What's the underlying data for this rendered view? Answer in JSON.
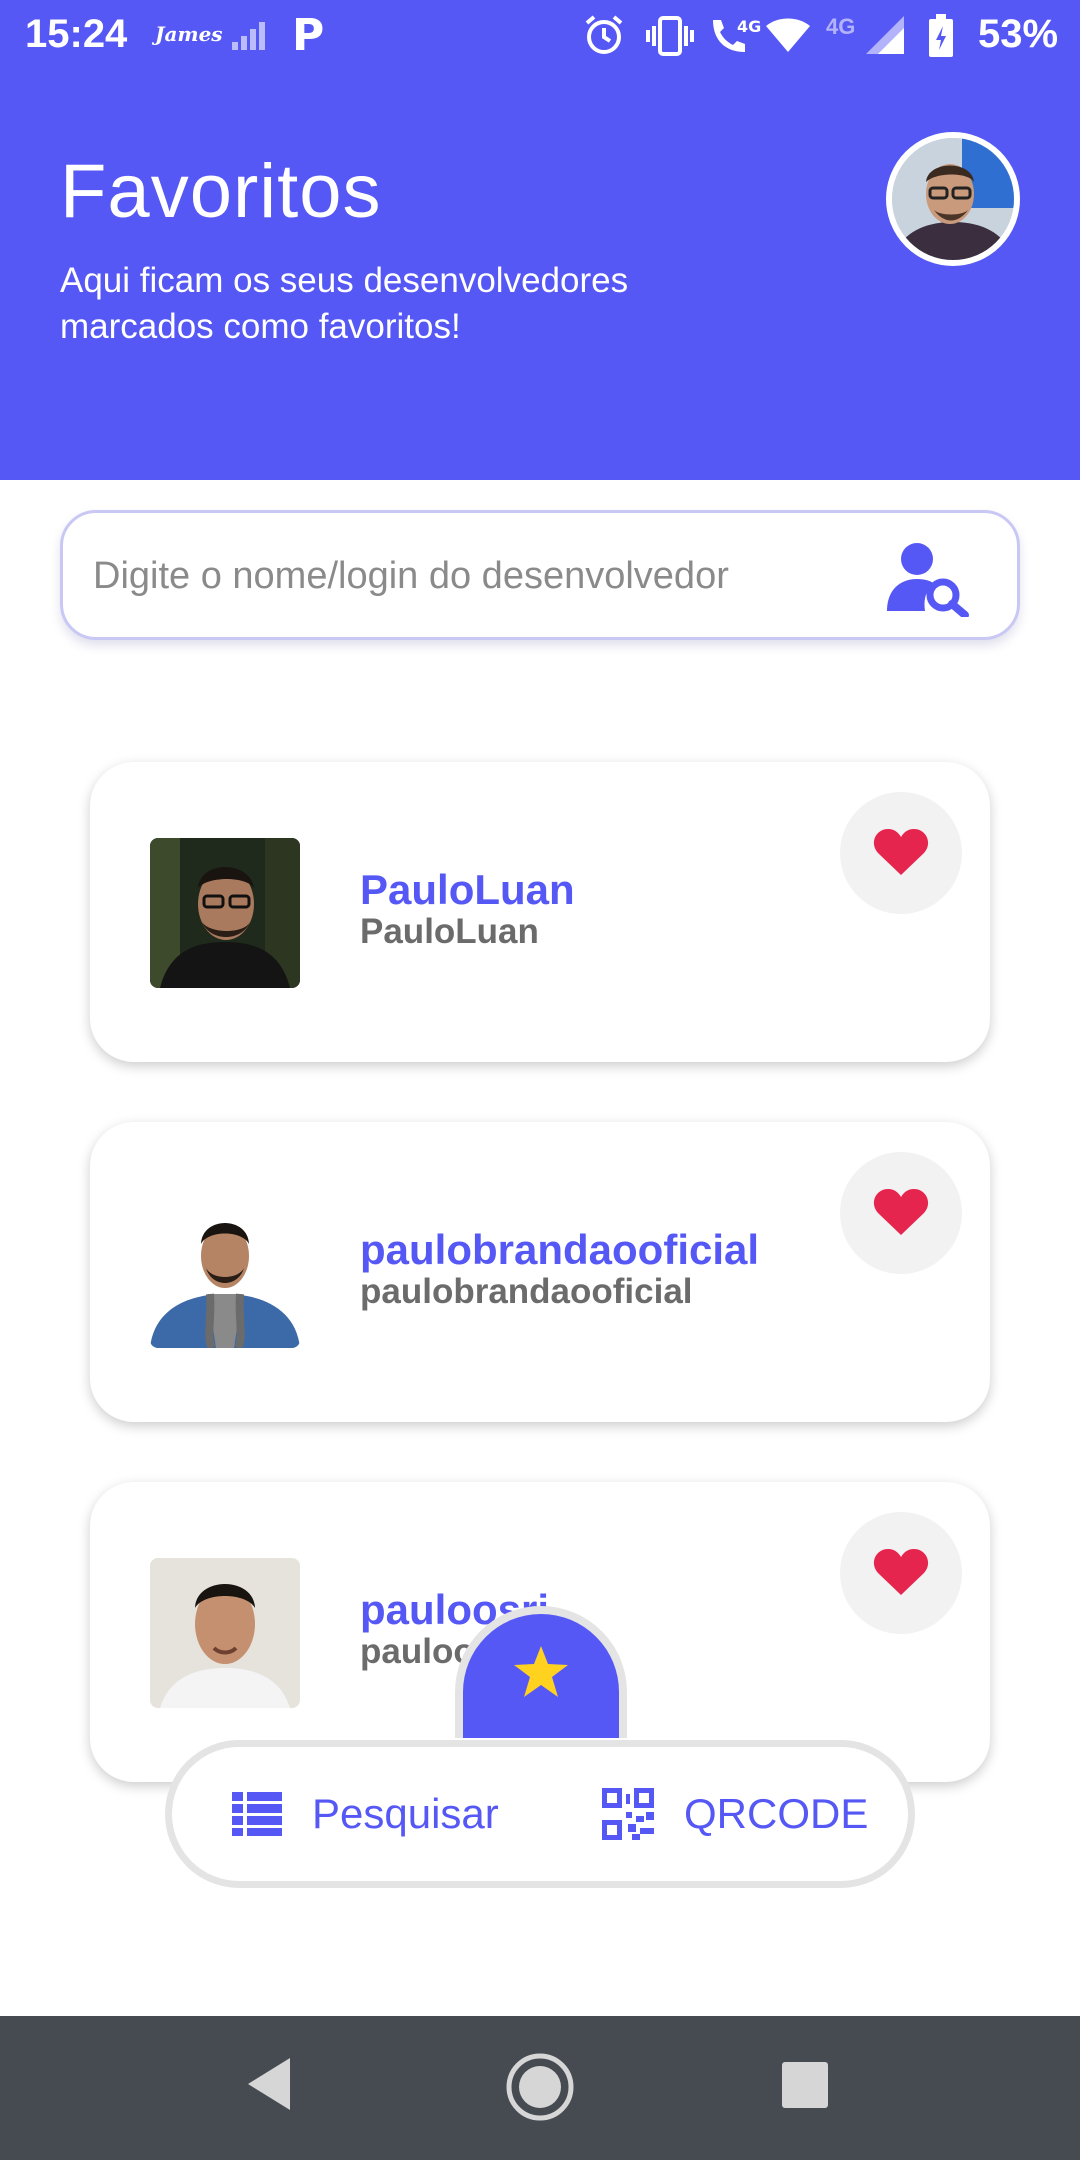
{
  "status_bar": {
    "time": "15:24",
    "carrier": "James",
    "p_icon": "P",
    "network_label": "4G",
    "call_label": "4G",
    "battery": "53%"
  },
  "header": {
    "title": "Favoritos",
    "subtitle": "Aqui ficam os seus desenvolvedores marcados como favoritos!"
  },
  "search": {
    "placeholder": "Digite o nome/login do desenvolvedor",
    "icon": "user-search-icon"
  },
  "favorites": [
    {
      "name": "PauloLuan",
      "login": "PauloLuan"
    },
    {
      "name": "paulobrandaooficial",
      "login": "paulobrandaooficial"
    },
    {
      "name": "pauloosri",
      "login": "pauloosri"
    }
  ],
  "bottom_nav": {
    "search_label": "Pesquisar",
    "qr_label": "QRCODE",
    "center_icon": "star-icon"
  },
  "colors": {
    "primary": "#5658f5",
    "heart": "#e5254e",
    "star": "#ffd21f",
    "system_nav": "#464b52"
  }
}
